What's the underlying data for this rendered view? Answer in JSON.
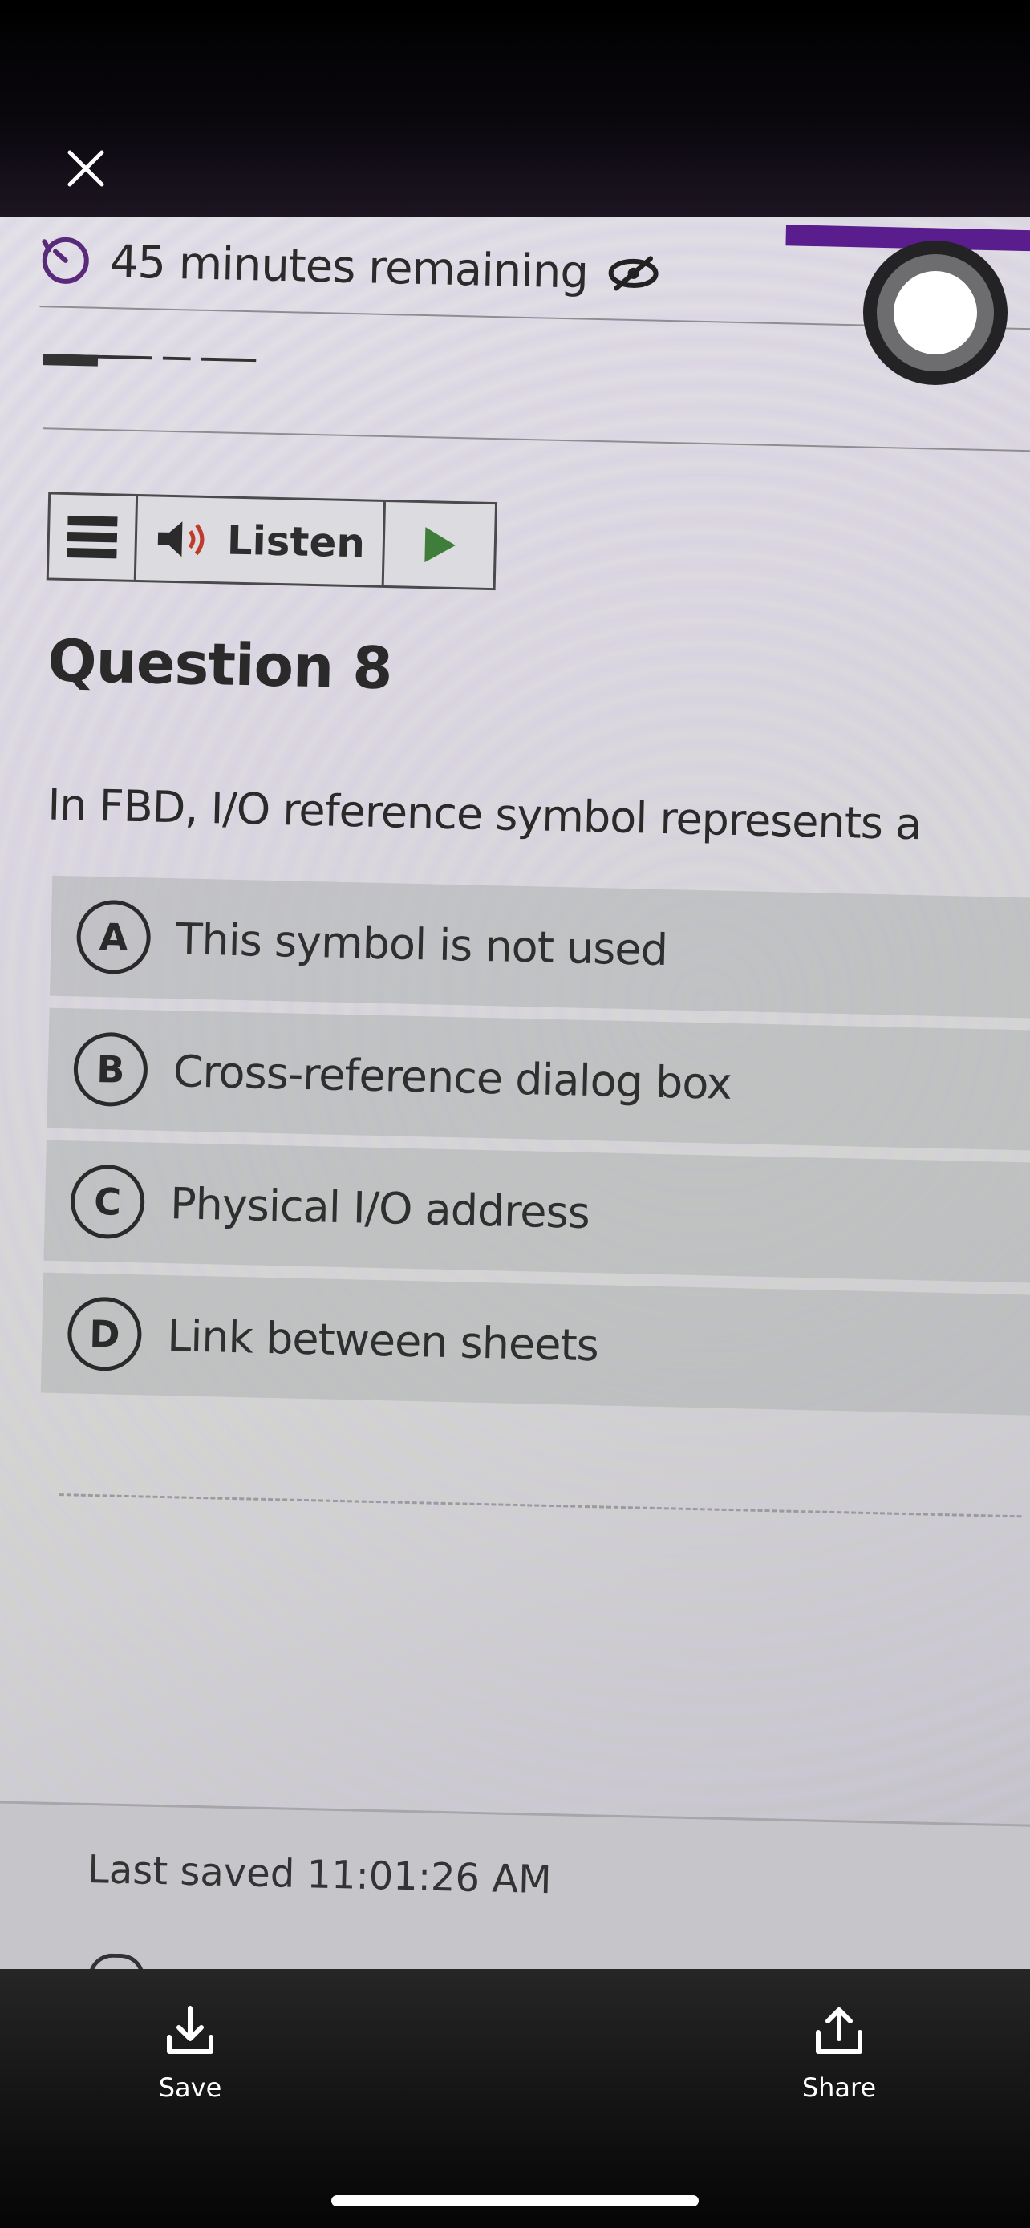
{
  "top_bar": {
    "close_icon": "close-icon"
  },
  "exam": {
    "timer_text": "45 minutes remaining",
    "timer_icon": "timer-icon",
    "hide_icon": "eye-slash-icon",
    "toolbar": {
      "menu_icon": "hamburger-menu-icon",
      "listen_label": "Listen",
      "speaker_icon": "speaker-icon",
      "play_icon": "play-icon"
    },
    "question_title": "Question 8",
    "question_text": "In FBD, I/O reference symbol represents a",
    "options": [
      {
        "letter": "A",
        "text": "This symbol is not used"
      },
      {
        "letter": "B",
        "text": "Cross-reference dialog box"
      },
      {
        "letter": "C",
        "text": "Physical I/O address"
      },
      {
        "letter": "D",
        "text": "Link between sheets"
      }
    ],
    "last_saved": "Last saved 11:01:26 AM"
  },
  "record_button": {
    "icon": "record-icon"
  },
  "bottom_bar": {
    "save_label": "Save",
    "share_label": "Share",
    "save_icon": "download-icon",
    "share_icon": "share-icon"
  },
  "colors": {
    "accent_purple": "#5a1d8e",
    "bar_background": "#1a1a1a"
  }
}
